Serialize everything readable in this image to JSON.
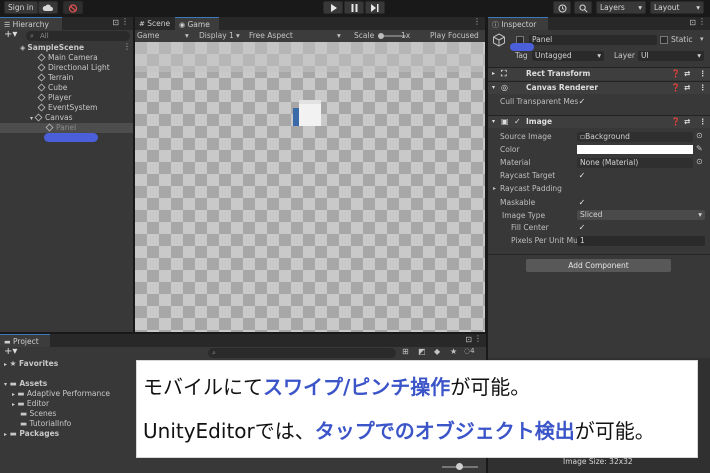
{
  "toolbar": {
    "sign_in": "Sign in",
    "layers": "Layers",
    "layout": "Layout"
  },
  "hierarchy": {
    "tab": "Hierarchy",
    "search_placeholder": "All",
    "scene": "SampleScene",
    "items": [
      "Main Camera",
      "Directional Light",
      "Terrain",
      "Cube",
      "Player",
      "EventSystem",
      "Canvas"
    ],
    "child": "Panel"
  },
  "scene_tab": "Scene",
  "game": {
    "tab": "Game",
    "display_mode": "Game",
    "display": "Display 1",
    "aspect": "Free Aspect",
    "scale_label": "Scale",
    "scale_value": "1x",
    "play_focused": "Play Focused"
  },
  "inspector": {
    "tab": "Inspector",
    "object_name": "Panel",
    "static_label": "Static",
    "tag_label": "Tag",
    "tag_value": "Untagged",
    "layer_label": "Layer",
    "layer_value": "UI",
    "rect_transform": "Rect Transform",
    "canvas_renderer": "Canvas Renderer",
    "cull_label": "Cull Transparent Mes",
    "image_section": "Image",
    "source_image_label": "Source Image",
    "source_image_value": "Background",
    "color_label": "Color",
    "material_label": "Material",
    "material_value": "None (Material)",
    "raycast_target": "Raycast Target",
    "raycast_padding": "Raycast Padding",
    "maskable": "Maskable",
    "image_type_label": "Image Type",
    "image_type_value": "Sliced",
    "fill_center": "Fill Center",
    "ppu_label": "Pixels Per Unit Mul",
    "ppu_value": "1",
    "add_component": "Add Component",
    "image_size": "Image Size: 32x32"
  },
  "project": {
    "tab": "Project",
    "favorites": "Favorites",
    "assets": "Assets",
    "asset_folders": [
      "Adaptive Performance",
      "Editor",
      "Scenes",
      "TutorialInfo"
    ],
    "packages": "Packages",
    "count": "4"
  },
  "caption": {
    "line1_a": "モバイルにて",
    "line1_b": "スワイプ/ピンチ操作",
    "line1_c": "が可能。",
    "line2_a": "UnityEditorでは、",
    "line2_b": "タップでのオブジェクト検出",
    "line2_c": "が可能。"
  },
  "colors": {
    "accent": "#3a79bb",
    "highlight": "#4a5fd9",
    "caption_bold": "#3b55c9",
    "panel": "#383838",
    "checker_light": "#c9c9c9",
    "checker_dark": "#a7a7a7"
  }
}
